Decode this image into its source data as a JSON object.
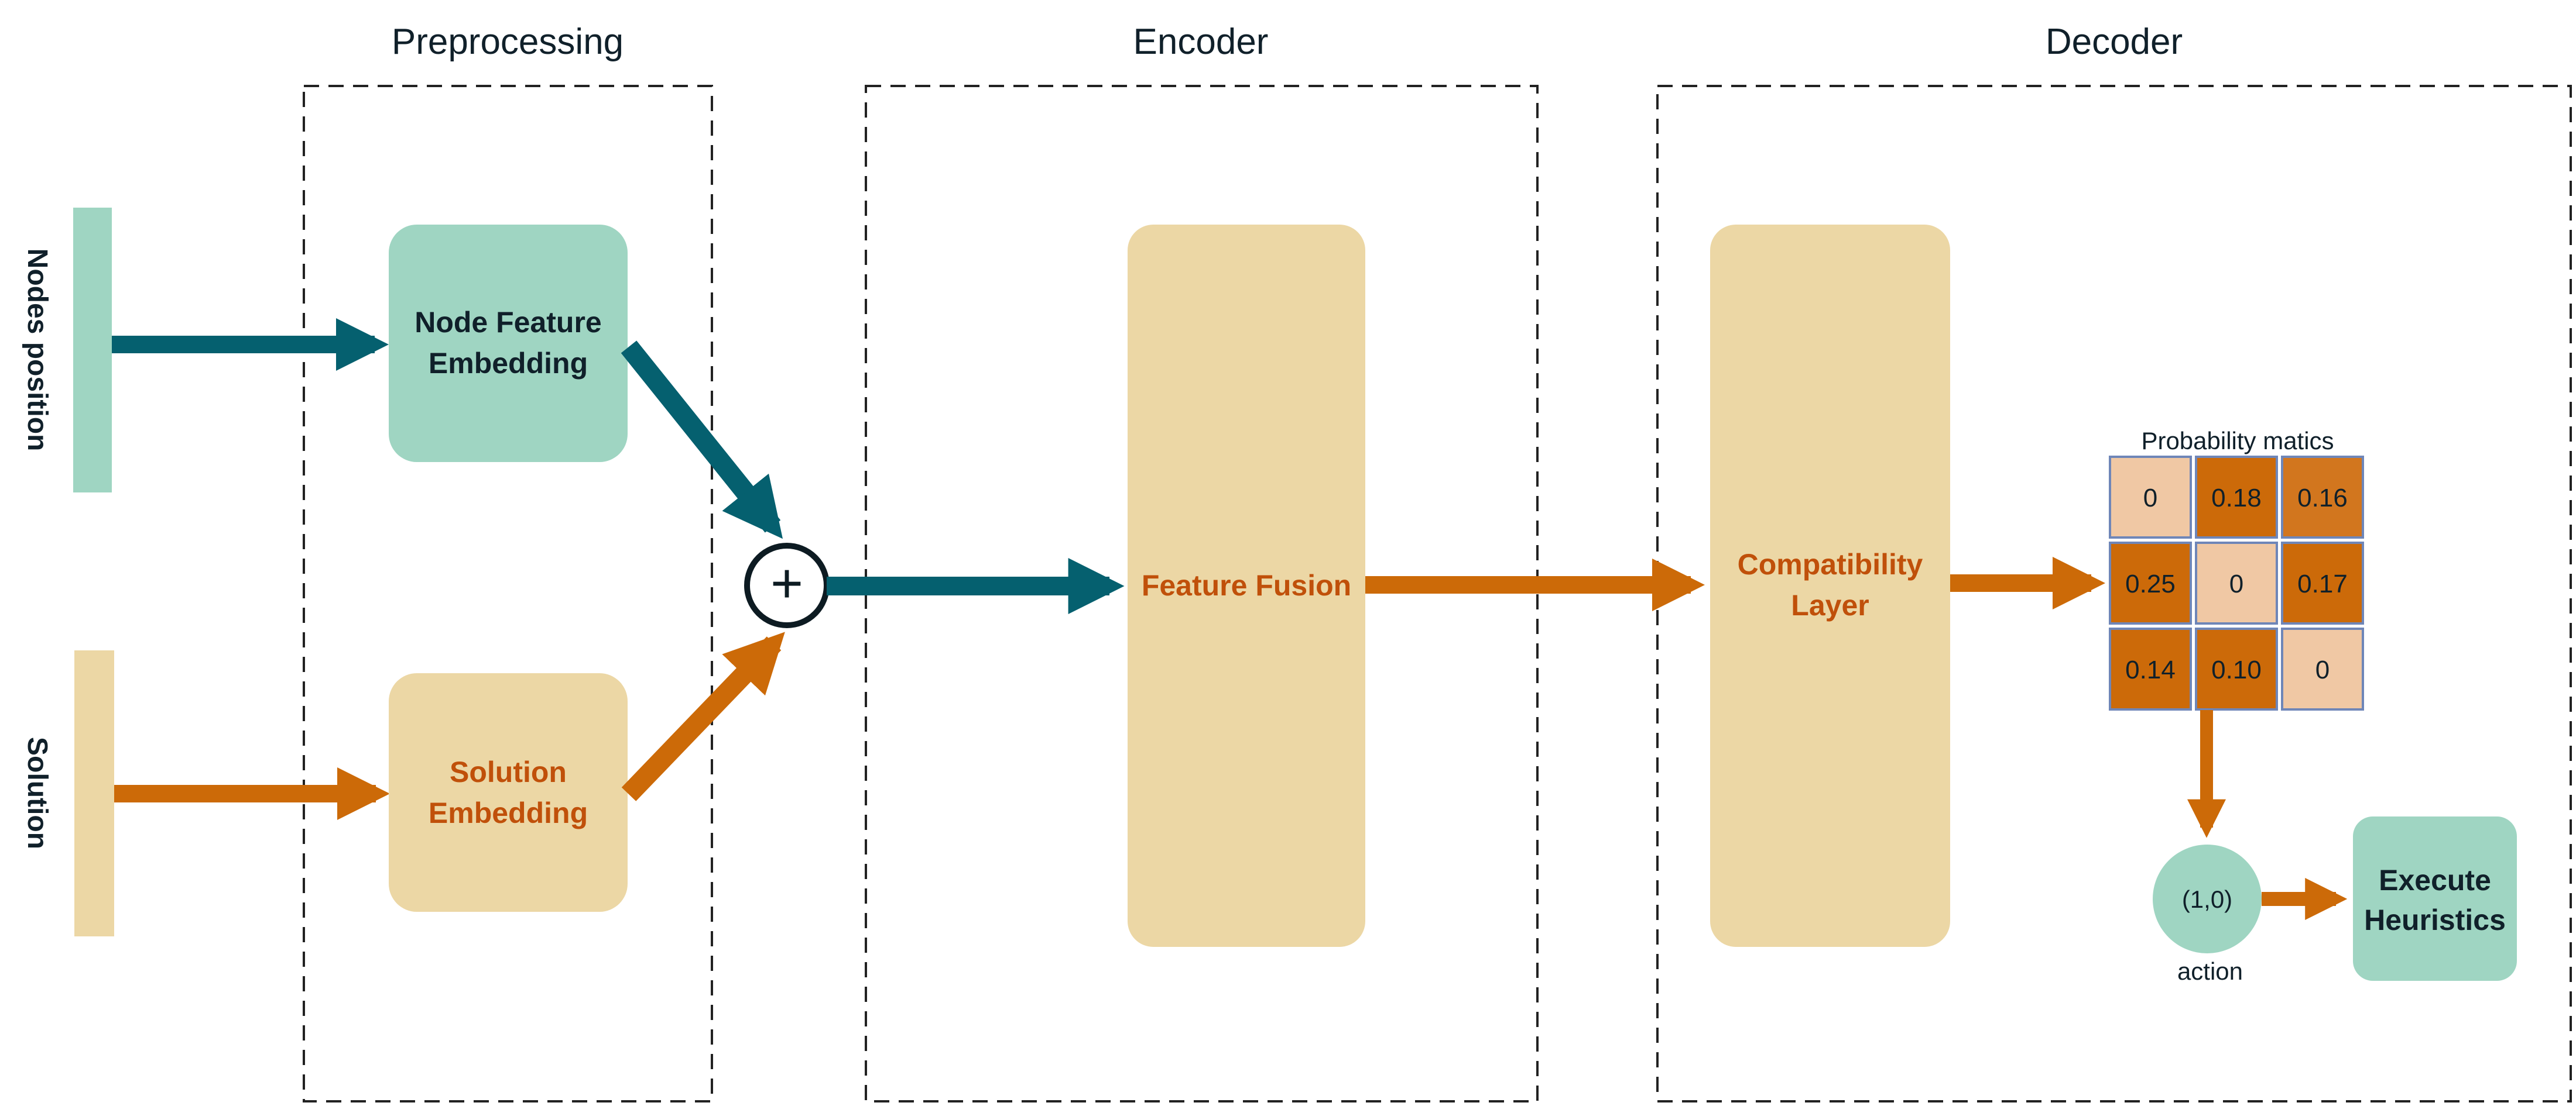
{
  "colors": {
    "teal_arrow": "#05606f",
    "orange_arrow": "#cc6a08",
    "mint_block": "#9fd5c2",
    "sand_block": "#ecd7a5",
    "cell_low": "#f0c8a4",
    "cell_high": "#cc6a09",
    "cell_mid": "#d2761e",
    "orange_text": "#c0500a"
  },
  "sections": {
    "preprocessing": "Preprocessing",
    "encoder": "Encoder",
    "decoder": "Decoder"
  },
  "inputs": {
    "nodes_position": "Nodes position",
    "solution": "Solution"
  },
  "blocks": {
    "node_feature_line1": "Node Feature",
    "node_feature_line2": "Embedding",
    "solution_line1": "Solution",
    "solution_line2": "Embedding",
    "feature_fusion": "Feature Fusion",
    "compat_line1": "Compatibility",
    "compat_line2": "Layer",
    "execute_line1": "Execute",
    "execute_line2": "Heuristics"
  },
  "sum_symbol": "+",
  "matrix": {
    "title": "Probability matics",
    "rows": [
      [
        "0",
        "0.18",
        "0.16"
      ],
      [
        "0.25",
        "0",
        "0.17"
      ],
      [
        "0.14",
        "0.10",
        "0"
      ]
    ]
  },
  "action": {
    "value": "(1,0)",
    "label": "action"
  }
}
